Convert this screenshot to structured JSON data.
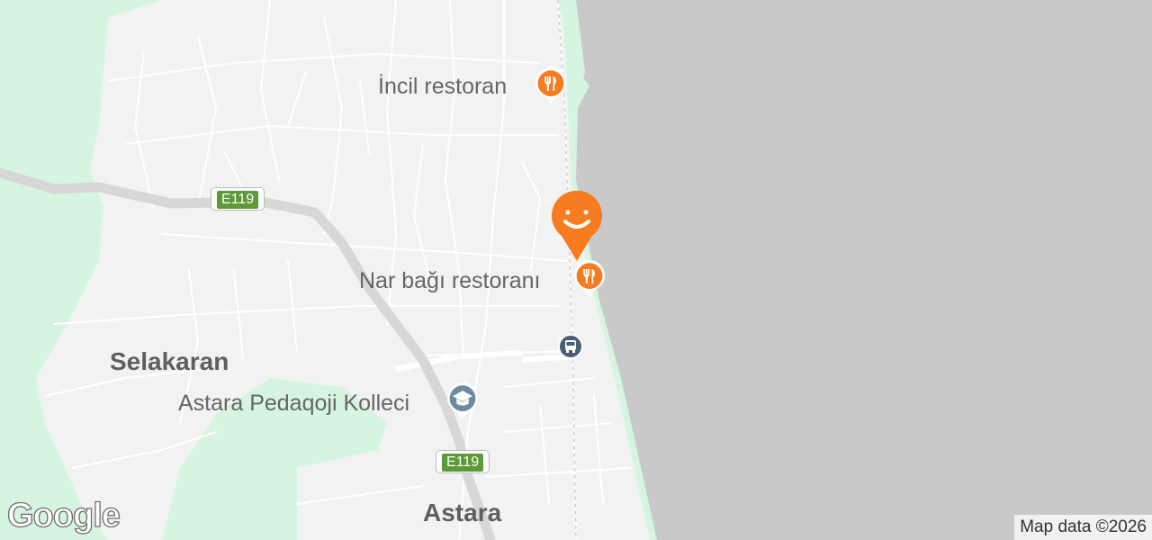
{
  "map": {
    "places": {
      "incil": "İncil restoran",
      "nar": "Nar bağı restoranı",
      "college": "Astara Pedaqoji Kolleci",
      "selakaran": "Selakaran",
      "astara": "Astara"
    },
    "highway_shield": "E119",
    "attribution": "Map data ©2026",
    "logo": "Google",
    "icons": {
      "restaurant": "fork-knife-icon",
      "smiley_marker": "smiley-icon",
      "education": "graduation-cap-icon",
      "bus": "bus-icon"
    },
    "colors": {
      "water": "#c9c9c9",
      "land": "#f2f2f2",
      "park": "#d6f5e1",
      "road": "#ffffff",
      "highway": "#d7d7d7",
      "restaurant_pin": "#f57c20",
      "education_pin": "#6d8aa0",
      "bus_stop": "#4a5f74",
      "shield": "#5e9a3a"
    }
  }
}
